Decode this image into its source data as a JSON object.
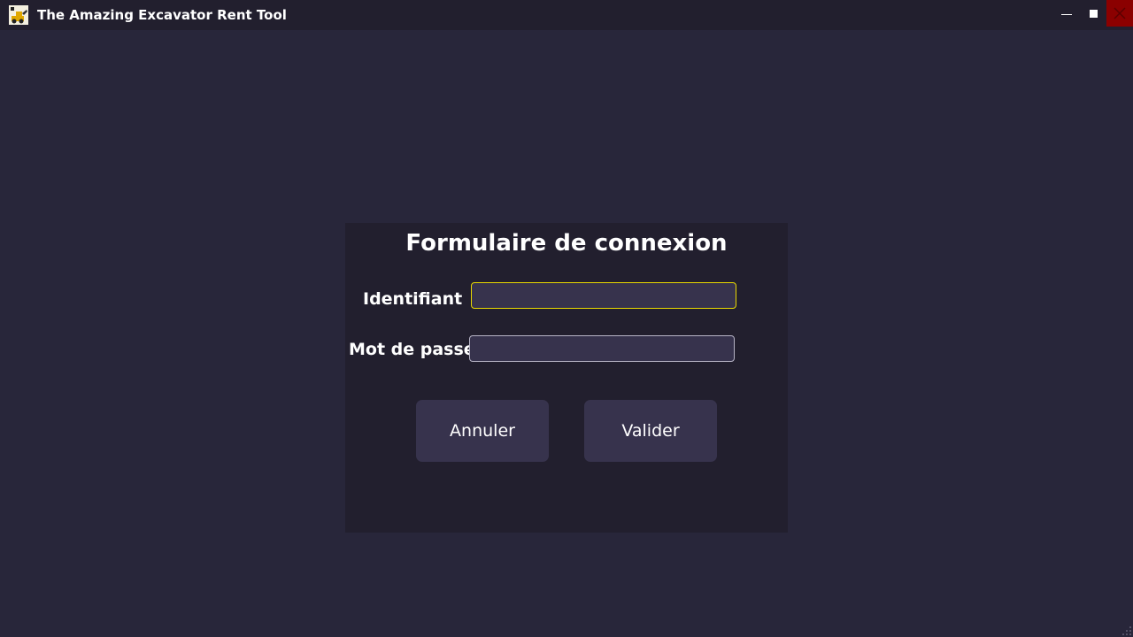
{
  "window": {
    "title": "The Amazing Excavator Rent Tool",
    "app_icon": "excavator-icon",
    "controls": {
      "minimize_icon": "minimize-icon",
      "maximize_icon": "maximize-icon",
      "close_icon": "close-icon"
    }
  },
  "form": {
    "title": "Formulaire de connexion",
    "username_label": "Identifiant",
    "username_value": "",
    "password_label": "Mot de passe",
    "password_value": "",
    "cancel_label": "Annuler",
    "submit_label": "Valider"
  },
  "colors": {
    "background": "#28263a",
    "panel": "#221f2e",
    "input_bg": "#37334d",
    "focus_border": "#e8d800",
    "close_button": "#8b0000"
  }
}
